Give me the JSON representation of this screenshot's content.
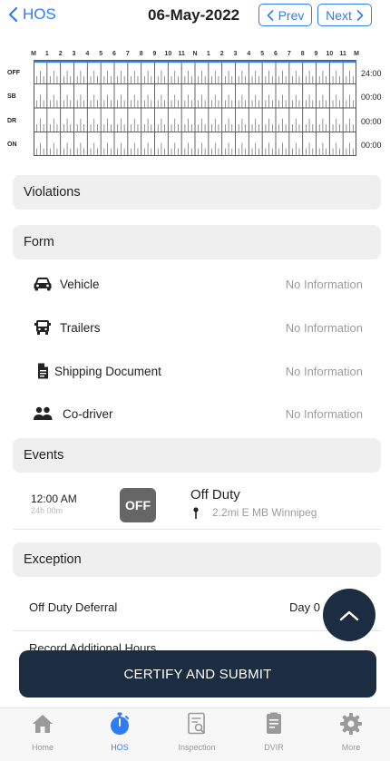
{
  "header": {
    "back_label": "HOS",
    "date": "06-May-2022",
    "prev_label": "Prev",
    "next_label": "Next"
  },
  "graph": {
    "hour_labels": [
      "M",
      "1",
      "2",
      "3",
      "4",
      "5",
      "6",
      "7",
      "8",
      "9",
      "10",
      "11",
      "N",
      "1",
      "2",
      "3",
      "4",
      "5",
      "6",
      "7",
      "8",
      "9",
      "10",
      "11",
      "M"
    ],
    "rows": [
      {
        "label": "OFF",
        "total": "24:00"
      },
      {
        "label": "SB",
        "total": "00:00"
      },
      {
        "label": "DR",
        "total": "00:00"
      },
      {
        "label": "ON",
        "total": "00:00"
      }
    ],
    "duty_line": {
      "status": "OFF",
      "from_hour": 0,
      "to_hour": 24
    },
    "line_color": "#2f7cf6"
  },
  "sections": {
    "violations": "Violations",
    "form": "Form",
    "events": "Events",
    "exception": "Exception"
  },
  "form_items": [
    {
      "icon": "car-icon",
      "label": "Vehicle",
      "value": "No Information"
    },
    {
      "icon": "truck-icon",
      "label": "Trailers",
      "value": "No Information"
    },
    {
      "icon": "document-icon",
      "label": "Shipping Document",
      "value": "No Information"
    },
    {
      "icon": "people-icon",
      "label": "Co-driver",
      "value": "No Information"
    }
  ],
  "event": {
    "time": "12:00 AM",
    "duration": "24h 00m",
    "badge": "OFF",
    "status": "Off Duty",
    "location": "2.2mi E MB Winnipeg"
  },
  "exceptions": [
    {
      "label": "Off Duty Deferral",
      "value": "Day 0"
    },
    {
      "label": "Record Additional Hours",
      "value": ""
    }
  ],
  "submit_label": "CERTIFY AND SUBMIT",
  "tabs": [
    {
      "icon": "home-icon",
      "label": "Home",
      "active": false
    },
    {
      "icon": "stopwatch-icon",
      "label": "HOS",
      "active": true
    },
    {
      "icon": "inspection-icon",
      "label": "Inspection",
      "active": false
    },
    {
      "icon": "clipboard-icon",
      "label": "DVIR",
      "active": false
    },
    {
      "icon": "gear-icon",
      "label": "More",
      "active": false
    }
  ],
  "colors": {
    "accent": "#2f7cf6",
    "dark_navy": "#1c2d42",
    "section_bg": "#efefef",
    "muted_text": "#9c9c9c",
    "badge_gray": "#666666"
  }
}
